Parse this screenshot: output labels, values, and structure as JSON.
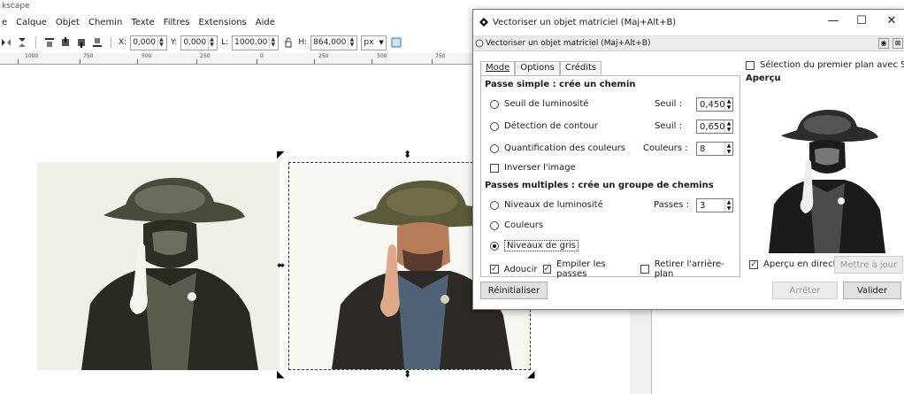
{
  "app": {
    "title": "kscape",
    "menu": [
      "Calque",
      "Objet",
      "Chemin",
      "Texte",
      "Filtres",
      "Extensions",
      "Aide"
    ],
    "menu_partial": "e"
  },
  "toolbar": {
    "x_label": "X:",
    "x_value": "0,000",
    "y_label": "Y:",
    "y_value": "0,000",
    "w_label": "L:",
    "w_value": "1000,00",
    "h_label": "H:",
    "h_value": "864,000",
    "unit": "px"
  },
  "ruler": {
    "labels": [
      "1000",
      "750",
      "500",
      "250",
      "0",
      "250",
      "500",
      "750"
    ]
  },
  "dialog": {
    "window_title": "Vectoriser un objet matriciel (Maj+Alt+B)",
    "dock_title": "Vectoriser un objet matriciel (Maj+Alt+B)",
    "tabs": [
      "Mode",
      "Options",
      "Crédits"
    ],
    "single_pass_header": "Passe simple : crée un chemin",
    "brightness_label": "Seuil de luminosité",
    "brightness_threshold_label": "Seuil :",
    "brightness_threshold_value": "0,450",
    "edge_label": "Détection de contour",
    "edge_threshold_label": "Seuil :",
    "edge_threshold_value": "0,650",
    "color_quant_label": "Quantification des couleurs",
    "colors_label": "Couleurs :",
    "colors_value": "8",
    "invert_label": "Inverser l'image",
    "multi_pass_header": "Passes multiples : crée un groupe de chemins",
    "brightness_steps_label": "Niveaux de luminosité",
    "passes_label": "Passes :",
    "passes_value": "3",
    "colors_option_label": "Couleurs",
    "grays_label": "Niveaux de gris",
    "smooth_label": "Adoucir",
    "stack_label": "Empiler les passes",
    "remove_bg_label": "Retirer l'arrière-plan",
    "sioxt_label": "Sélection du premier plan avec SIOX",
    "preview_header": "Aperçu",
    "live_preview_label": "Aperçu en direct",
    "update_button": "Mettre à jour",
    "reset_button": "Réinitialiser",
    "stop_button": "Arrêter",
    "ok_button": "Valider",
    "selected_mode": "grays",
    "checks": {
      "invert": false,
      "smooth": true,
      "stack": true,
      "remove_bg": false,
      "siox": false,
      "live_preview": true
    }
  }
}
